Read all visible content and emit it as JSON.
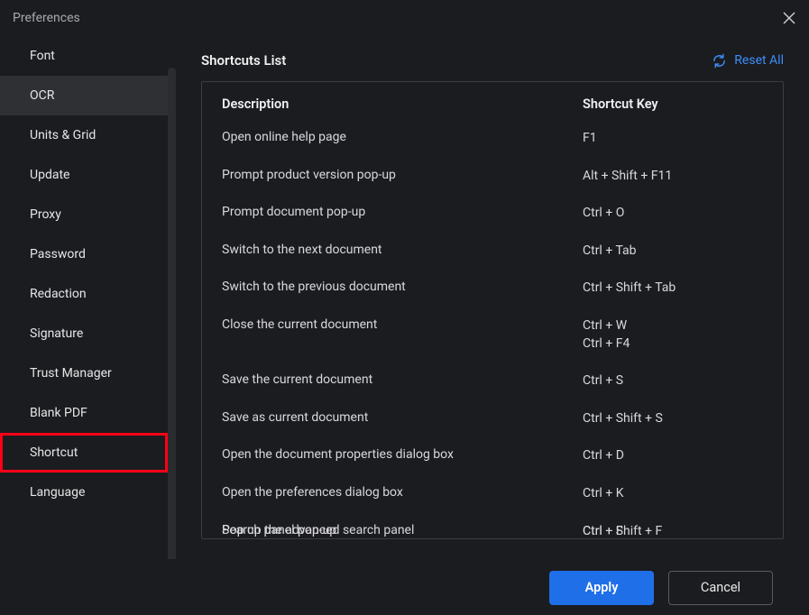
{
  "window": {
    "title": "Preferences"
  },
  "sidebar": {
    "items": [
      {
        "label": "Font"
      },
      {
        "label": "OCR",
        "active": true
      },
      {
        "label": "Units & Grid"
      },
      {
        "label": "Update"
      },
      {
        "label": "Proxy"
      },
      {
        "label": "Password"
      },
      {
        "label": "Redaction"
      },
      {
        "label": "Signature"
      },
      {
        "label": "Trust Manager"
      },
      {
        "label": "Blank PDF"
      },
      {
        "label": "Shortcut",
        "highlighted": true
      },
      {
        "label": "Language"
      }
    ]
  },
  "content": {
    "title": "Shortcuts List",
    "reset_label": "Reset All",
    "col_description": "Description",
    "col_shortcut": "Shortcut Key",
    "rows": [
      {
        "desc": "Open online help page",
        "key": "F1"
      },
      {
        "desc": "Prompt product version pop-up",
        "key": "Alt + Shift + F11"
      },
      {
        "desc": "Prompt document pop-up",
        "key": "Ctrl + O"
      },
      {
        "desc": "Switch to the next document",
        "key": "Ctrl + Tab"
      },
      {
        "desc": "Switch to the previous document",
        "key": "Ctrl + Shift + Tab"
      },
      {
        "desc": "Close the current document",
        "key": "Ctrl + W\nCtrl + F4"
      },
      {
        "desc": "Save the current document",
        "key": "Ctrl + S"
      },
      {
        "desc": "Save as current document",
        "key": "Ctrl + Shift + S"
      },
      {
        "desc": "Open the document properties dialog box",
        "key": "Ctrl + D"
      },
      {
        "desc": "Open the preferences dialog box",
        "key": "Ctrl + K"
      },
      {
        "desc": "Search panel pop-up",
        "key": "Ctrl + F"
      }
    ],
    "cut_row": {
      "desc": "Pop up the advanced search panel",
      "key": "Ctrl + Shift + F"
    }
  },
  "footer": {
    "apply": "Apply",
    "cancel": "Cancel"
  }
}
